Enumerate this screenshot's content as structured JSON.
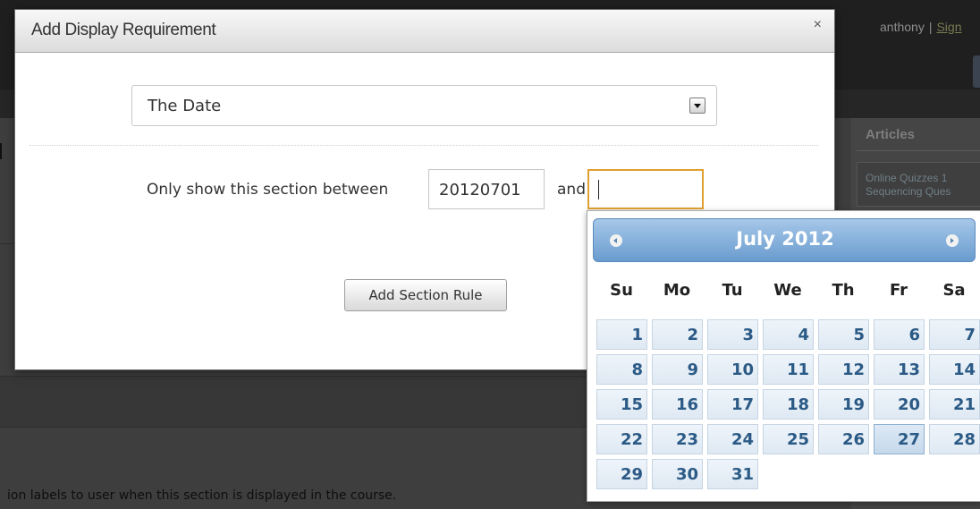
{
  "background": {
    "user_name": "anthony",
    "separator": "|",
    "sign_link": "Sign",
    "articles_heading": "Articles",
    "article_line1": "Online Quizzes 1",
    "article_line2": "Sequencing Ques",
    "footer_text": "ion labels to user when this section is displayed in the course."
  },
  "modal": {
    "title": "Add Display Requirement",
    "close": "×",
    "requirement_select": {
      "value": "The Date"
    },
    "rule_label": "Only show this section between",
    "from_date": "20120701",
    "and_label": "and",
    "to_date": "",
    "add_button": "Add Section Rule"
  },
  "datepicker": {
    "month_title": "July 2012",
    "weekdays": [
      "Su",
      "Mo",
      "Tu",
      "We",
      "Th",
      "Fr",
      "Sa"
    ],
    "first_weekday_index": 0,
    "days_in_month": 31,
    "today": 27,
    "prev_icon": "prev-arrow-icon",
    "next_icon": "next-arrow-icon"
  },
  "colors": {
    "calendar_header": "#7aa7d6",
    "focus_border": "#e0a030",
    "day_text": "#2b5a86"
  }
}
